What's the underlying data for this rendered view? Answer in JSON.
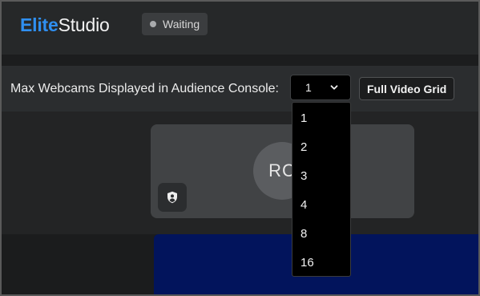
{
  "header": {
    "logo_part1": "Elite",
    "logo_part2": "Studio",
    "status": "Waiting"
  },
  "controls": {
    "label": "Max Webcams Displayed in Audience Console:",
    "selected": "1",
    "full_grid_button": "Full Video Grid"
  },
  "dropdown": {
    "options": [
      "1",
      "2",
      "3",
      "4",
      "8",
      "16"
    ]
  },
  "participant": {
    "initials": "RC",
    "icon": "shield-user-icon"
  },
  "colors": {
    "brand": "#2f8ff0",
    "video_panel": "#02145c"
  }
}
